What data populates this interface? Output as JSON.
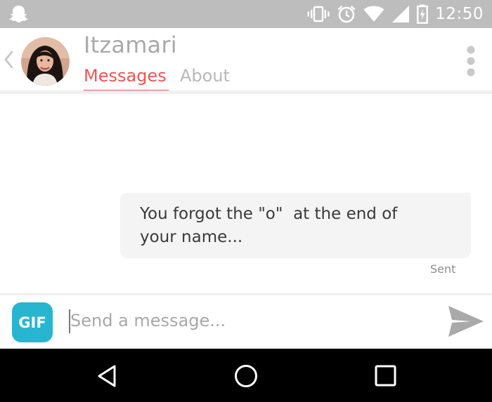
{
  "status_bar": {
    "time": "12:50",
    "icons": [
      "snapchat-ghost-icon",
      "vibrate-icon",
      "alarm-icon",
      "wifi-icon",
      "signal-icon",
      "battery-charging-icon"
    ]
  },
  "header": {
    "contact_name": "Itzamari",
    "tabs": [
      {
        "label": "Messages",
        "active": true
      },
      {
        "label": "About",
        "active": false
      }
    ],
    "icons": [
      "back-chevron-icon",
      "overflow-menu-icon"
    ]
  },
  "conversation": {
    "messages": [
      {
        "direction": "outgoing",
        "text": "You forgot the \"o\"  at the end of\nyour name...",
        "status": "Sent"
      }
    ]
  },
  "composer": {
    "gif_label": "GIF",
    "placeholder": "Send a message...",
    "value": "",
    "send_icon": "send-icon"
  },
  "nav_bar": {
    "icons": [
      "nav-back-icon",
      "nav-home-icon",
      "nav-recents-icon"
    ]
  },
  "colors": {
    "status_bar_bg": "#bdbdbd",
    "accent": "#ee5454",
    "gif_button": "#28b5cf",
    "bubble_bg": "#f4f4f4",
    "nav_bar_bg": "#000000"
  }
}
